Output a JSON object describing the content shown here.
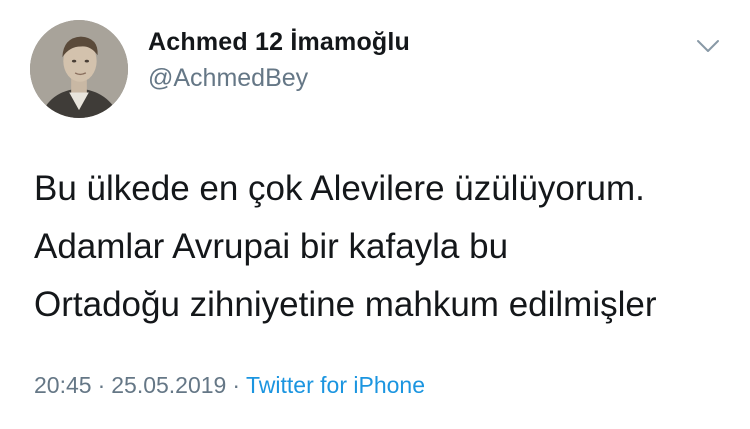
{
  "user": {
    "display_name": "Achmed 12 İmamoğlu",
    "handle": "@AchmedBey"
  },
  "tweet": {
    "lines": [
      "Bu ülkede en çok Alevilere üzülüyorum.",
      "Adamlar Avrupai bir kafayla bu",
      "Ortadoğu zihniyetine mahkum edilmişler"
    ],
    "time": "20:45",
    "date": "25.05.2019",
    "separator": "·",
    "source": "Twitter for iPhone"
  },
  "icons": {
    "avatar": "profile-photo",
    "caret": "chevron-down-icon"
  },
  "colors": {
    "text": "#14171a",
    "secondary": "#657786",
    "link": "#1b95e0",
    "background": "#ffffff"
  }
}
